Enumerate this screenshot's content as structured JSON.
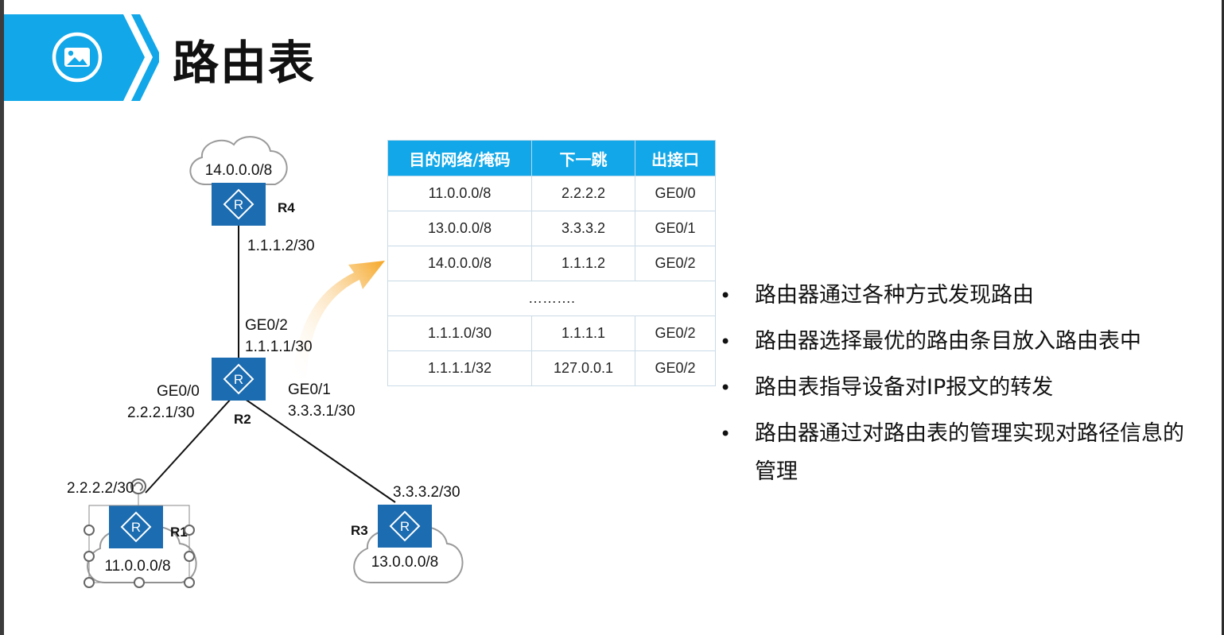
{
  "title": "路由表",
  "title_icon": "image-icon",
  "colors": {
    "accent": "#11a7e8",
    "router": "#1b6cb1",
    "arrow": "#f5a623"
  },
  "table": {
    "headers": [
      "目的网络/掩码",
      "下一跳",
      "出接口"
    ],
    "rows": [
      [
        "11.0.0.0/8",
        "2.2.2.2",
        "GE0/0"
      ],
      [
        "13.0.0.0/8",
        "3.3.3.2",
        "GE0/1"
      ],
      [
        "14.0.0.0/8",
        "1.1.1.2",
        "GE0/2"
      ],
      [
        "……….",
        "",
        ""
      ],
      [
        "1.1.1.0/30",
        "1.1.1.1",
        "GE0/2"
      ],
      [
        "1.1.1.1/32",
        "127.0.0.1",
        "GE0/2"
      ]
    ]
  },
  "bullets": [
    "路由器通过各种方式发现路由",
    "路由器选择最优的路由条目放入路由表中",
    "路由表指导设备对IP报文的转发",
    "路由器通过对路由表的管理实现对路径信息的管理"
  ],
  "diagram": {
    "routers": {
      "r4": {
        "name": "R4",
        "icon": "router-icon"
      },
      "r2": {
        "name": "R2",
        "icon": "router-icon"
      },
      "r1": {
        "name": "R1",
        "icon": "router-icon"
      },
      "r3": {
        "name": "R3",
        "icon": "router-icon"
      }
    },
    "clouds": {
      "r4": "14.0.0.0/8",
      "r1": "11.0.0.0/8",
      "r3": "13.0.0.0/8"
    },
    "labels": {
      "r4_ip": "1.1.1.2/30",
      "r2_ge02": "GE0/2",
      "r2_ge02_ip": "1.1.1.1/30",
      "r2_ge00": "GE0/0",
      "r2_ge00_ip": "2.2.2.1/30",
      "r2_ge01": "GE0/1",
      "r2_ge01_ip": "3.3.3.1/30",
      "r1_ip": "2.2.2.2/30",
      "r3_ip": "3.3.3.2/30"
    }
  }
}
